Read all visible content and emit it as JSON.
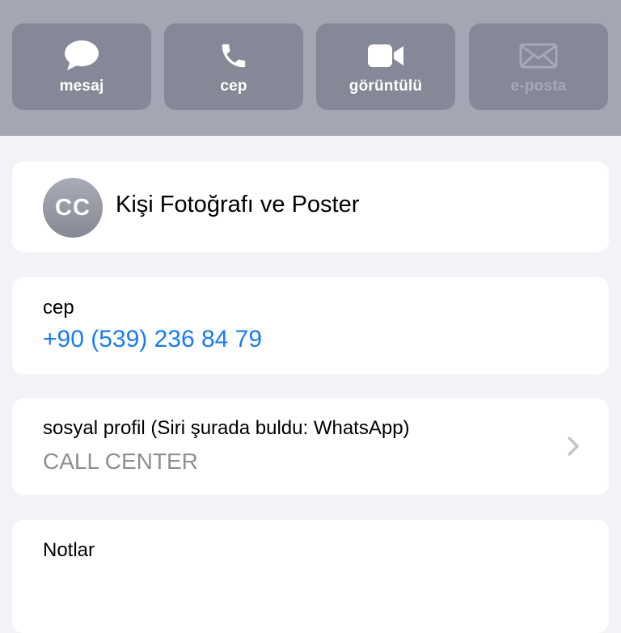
{
  "actions": [
    {
      "label": "mesaj",
      "icon": "message-bubble-icon",
      "enabled": true
    },
    {
      "label": "cep",
      "icon": "phone-icon",
      "enabled": true
    },
    {
      "label": "görüntülü",
      "icon": "video-camera-icon",
      "enabled": true
    },
    {
      "label": "e-posta",
      "icon": "envelope-icon",
      "enabled": false
    }
  ],
  "poster": {
    "avatar_initials": "CC",
    "title": "Kişi Fotoğrafı ve Poster"
  },
  "phone": {
    "label": "cep",
    "number": "+90 (539) 236 84 79"
  },
  "social": {
    "label": "sosyal profil (Siri şurada buldu: WhatsApp)",
    "value": "CALL CENTER"
  },
  "notes": {
    "label": "Notlar",
    "content": ""
  },
  "colors": {
    "top_bar": "#a3a6b3",
    "action_button": "#858896",
    "link_blue": "#1a7cf2",
    "secondary_text": "#8e8e93",
    "background": "#f2f2f7"
  }
}
